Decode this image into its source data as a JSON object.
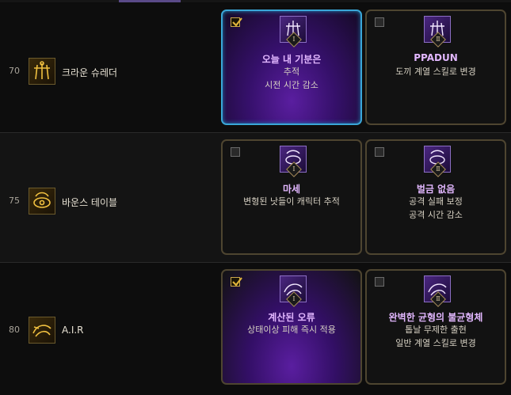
{
  "rows": [
    {
      "level": "70",
      "skill_name": "크라운 슈레더",
      "skill_icon": "crown-shredder-icon",
      "options": [
        {
          "selected": true,
          "rank": "Ⅰ",
          "title": "오늘 내 기분은",
          "desc": [
            "추적",
            "시전 시간 감소"
          ]
        },
        {
          "selected": false,
          "rank": "Ⅱ",
          "title": "PPADUN",
          "desc": [
            "도끼 계열 스킬로 변경"
          ]
        }
      ]
    },
    {
      "level": "75",
      "skill_name": "바운스 테이블",
      "skill_icon": "bounce-table-icon",
      "options": [
        {
          "selected": false,
          "rank": "Ⅰ",
          "title": "마세",
          "desc": [
            "변형된 낫들이 캐릭터 추적"
          ]
        },
        {
          "selected": false,
          "rank": "Ⅱ",
          "title": "벌금 없음",
          "desc": [
            "공격 실패 보정",
            "공격 시간 감소"
          ]
        }
      ]
    },
    {
      "level": "80",
      "skill_name": "A.I.R",
      "skill_icon": "air-icon",
      "options": [
        {
          "selected": true,
          "rank": "Ⅰ",
          "title": "계산된 오류",
          "desc": [
            "상태이상 피해 즉시 적용"
          ]
        },
        {
          "selected": false,
          "rank": "Ⅱ",
          "title": "완벽한 균형의 불균형체",
          "desc": [
            "톱날 무제한 출현",
            "일반 계열 스킬로 변경"
          ]
        }
      ]
    }
  ],
  "colors": {
    "selected_border": "#3aa7d8",
    "card_border": "#4e4530",
    "title": "#e2b7ff",
    "accent_purple": "#5a1ea0"
  }
}
